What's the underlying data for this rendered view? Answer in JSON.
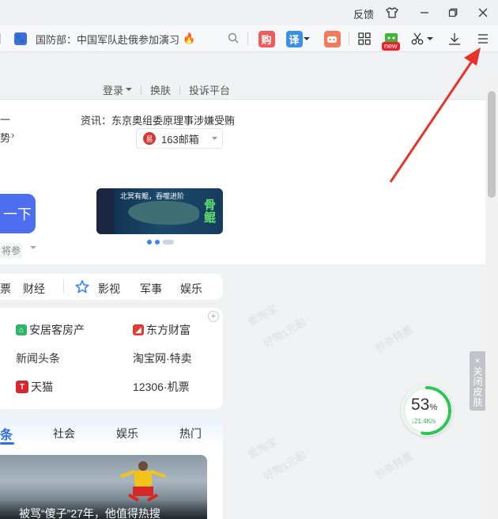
{
  "window": {
    "feedback_label": "反馈",
    "shirt_icon": "tshirt-icon",
    "min_icon": "minimize-icon",
    "max_icon": "restore-icon",
    "close_icon": "close-icon"
  },
  "toolbar": {
    "address_text": "国防部：中国军队赴俄参加演习",
    "hot_icon": "flame-icon",
    "shop_label": "购",
    "translate_label": "译",
    "new_badge": "new",
    "accent_red": "#f05a5a",
    "accent_blue": "#3b8fe8"
  },
  "topnav": {
    "login": "登录",
    "skin": "换肤",
    "complaint": "投诉平台"
  },
  "hero": {
    "line1": "一",
    "line2": "势",
    "news_label": "资讯：东京奥组委原理事涉嫌受贿",
    "mail_label": "163邮箱",
    "search_button_label": "一下",
    "hint_label": "将参",
    "banner_title": "北冥有鲲，吞噬进阶",
    "banner_logo": "骨鲲"
  },
  "categories": {
    "finance": "财经",
    "video": "影视",
    "military": "军事",
    "entertainment": "娱乐",
    "partial_left": "票"
  },
  "quick_links": [
    {
      "label": "安居客房产",
      "badge": "⌂",
      "color": "#2fb56a"
    },
    {
      "label": "东方财富",
      "badge": "◢",
      "color": "#e23b33"
    },
    {
      "label": "新闻头条",
      "badge": "",
      "color": ""
    },
    {
      "label": "淘宝网·特卖",
      "badge": "",
      "color": ""
    },
    {
      "label": "天猫",
      "badge": "T",
      "color": "#d8262b"
    },
    {
      "label": "12306·机票",
      "badge": "",
      "color": ""
    }
  ],
  "news_tabs": {
    "active": "条",
    "society": "社会",
    "entertainment": "娱乐",
    "hot": "热门"
  },
  "news_headline": "被骂“傻子”27年，他值得热搜",
  "skin_panel": {
    "close_skin_label": "关闭皮肤",
    "close_x": "×"
  },
  "speed": {
    "percent": "53",
    "percent_unit": "%",
    "rate": "21.4K/s",
    "progress_fraction": 0.53
  },
  "watermarks": {
    "brand": "爱淘宝",
    "promo": "好物1元起",
    "flash": "秒杀特惠"
  }
}
